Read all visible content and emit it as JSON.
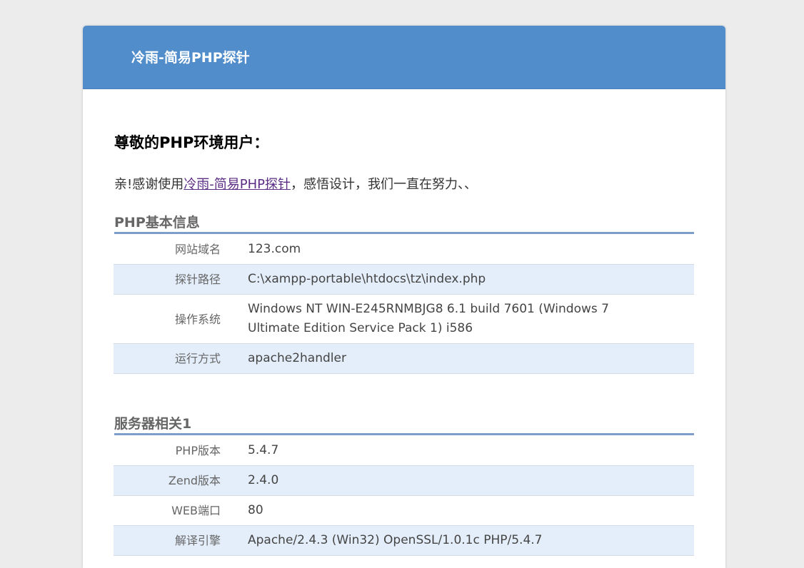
{
  "header": {
    "title": "冷雨-简易PHP探针"
  },
  "greeting": "尊敬的PHP环境用户：",
  "intro": {
    "prefix": "亲!感谢使用",
    "link_text": "冷雨-简易PHP探针",
    "suffix": "，感悟设计，我们一直在努力、、"
  },
  "sections": [
    {
      "title": "PHP基本信息",
      "rows": [
        {
          "label": "网站域名",
          "value": "123.com"
        },
        {
          "label": "探针路径",
          "value": "C:\\xampp-portable\\htdocs\\tz\\index.php"
        },
        {
          "label": "操作系统",
          "value_line1": "Windows NT WIN-E245RNMBJG8 6.1 build 7601 (Windows 7",
          "value_line2": "Ultimate Edition Service Pack 1) i586"
        },
        {
          "label": "运行方式",
          "value": "apache2handler"
        }
      ]
    },
    {
      "title": "服务器相关1",
      "rows": [
        {
          "label": "PHP版本",
          "value": "5.4.7"
        },
        {
          "label": "Zend版本",
          "value": "2.4.0"
        },
        {
          "label": "WEB端口",
          "value": "80"
        },
        {
          "label": "解译引擎",
          "value": "Apache/2.4.3 (Win32) OpenSSL/1.0.1c PHP/5.4.7"
        }
      ]
    }
  ],
  "colors": {
    "header_bg": "#518ccb",
    "page_bg": "#ececec",
    "row_alt_bg": "#e4eefa",
    "section_rule": "#7e9dc8",
    "link": "#5b2c83"
  }
}
